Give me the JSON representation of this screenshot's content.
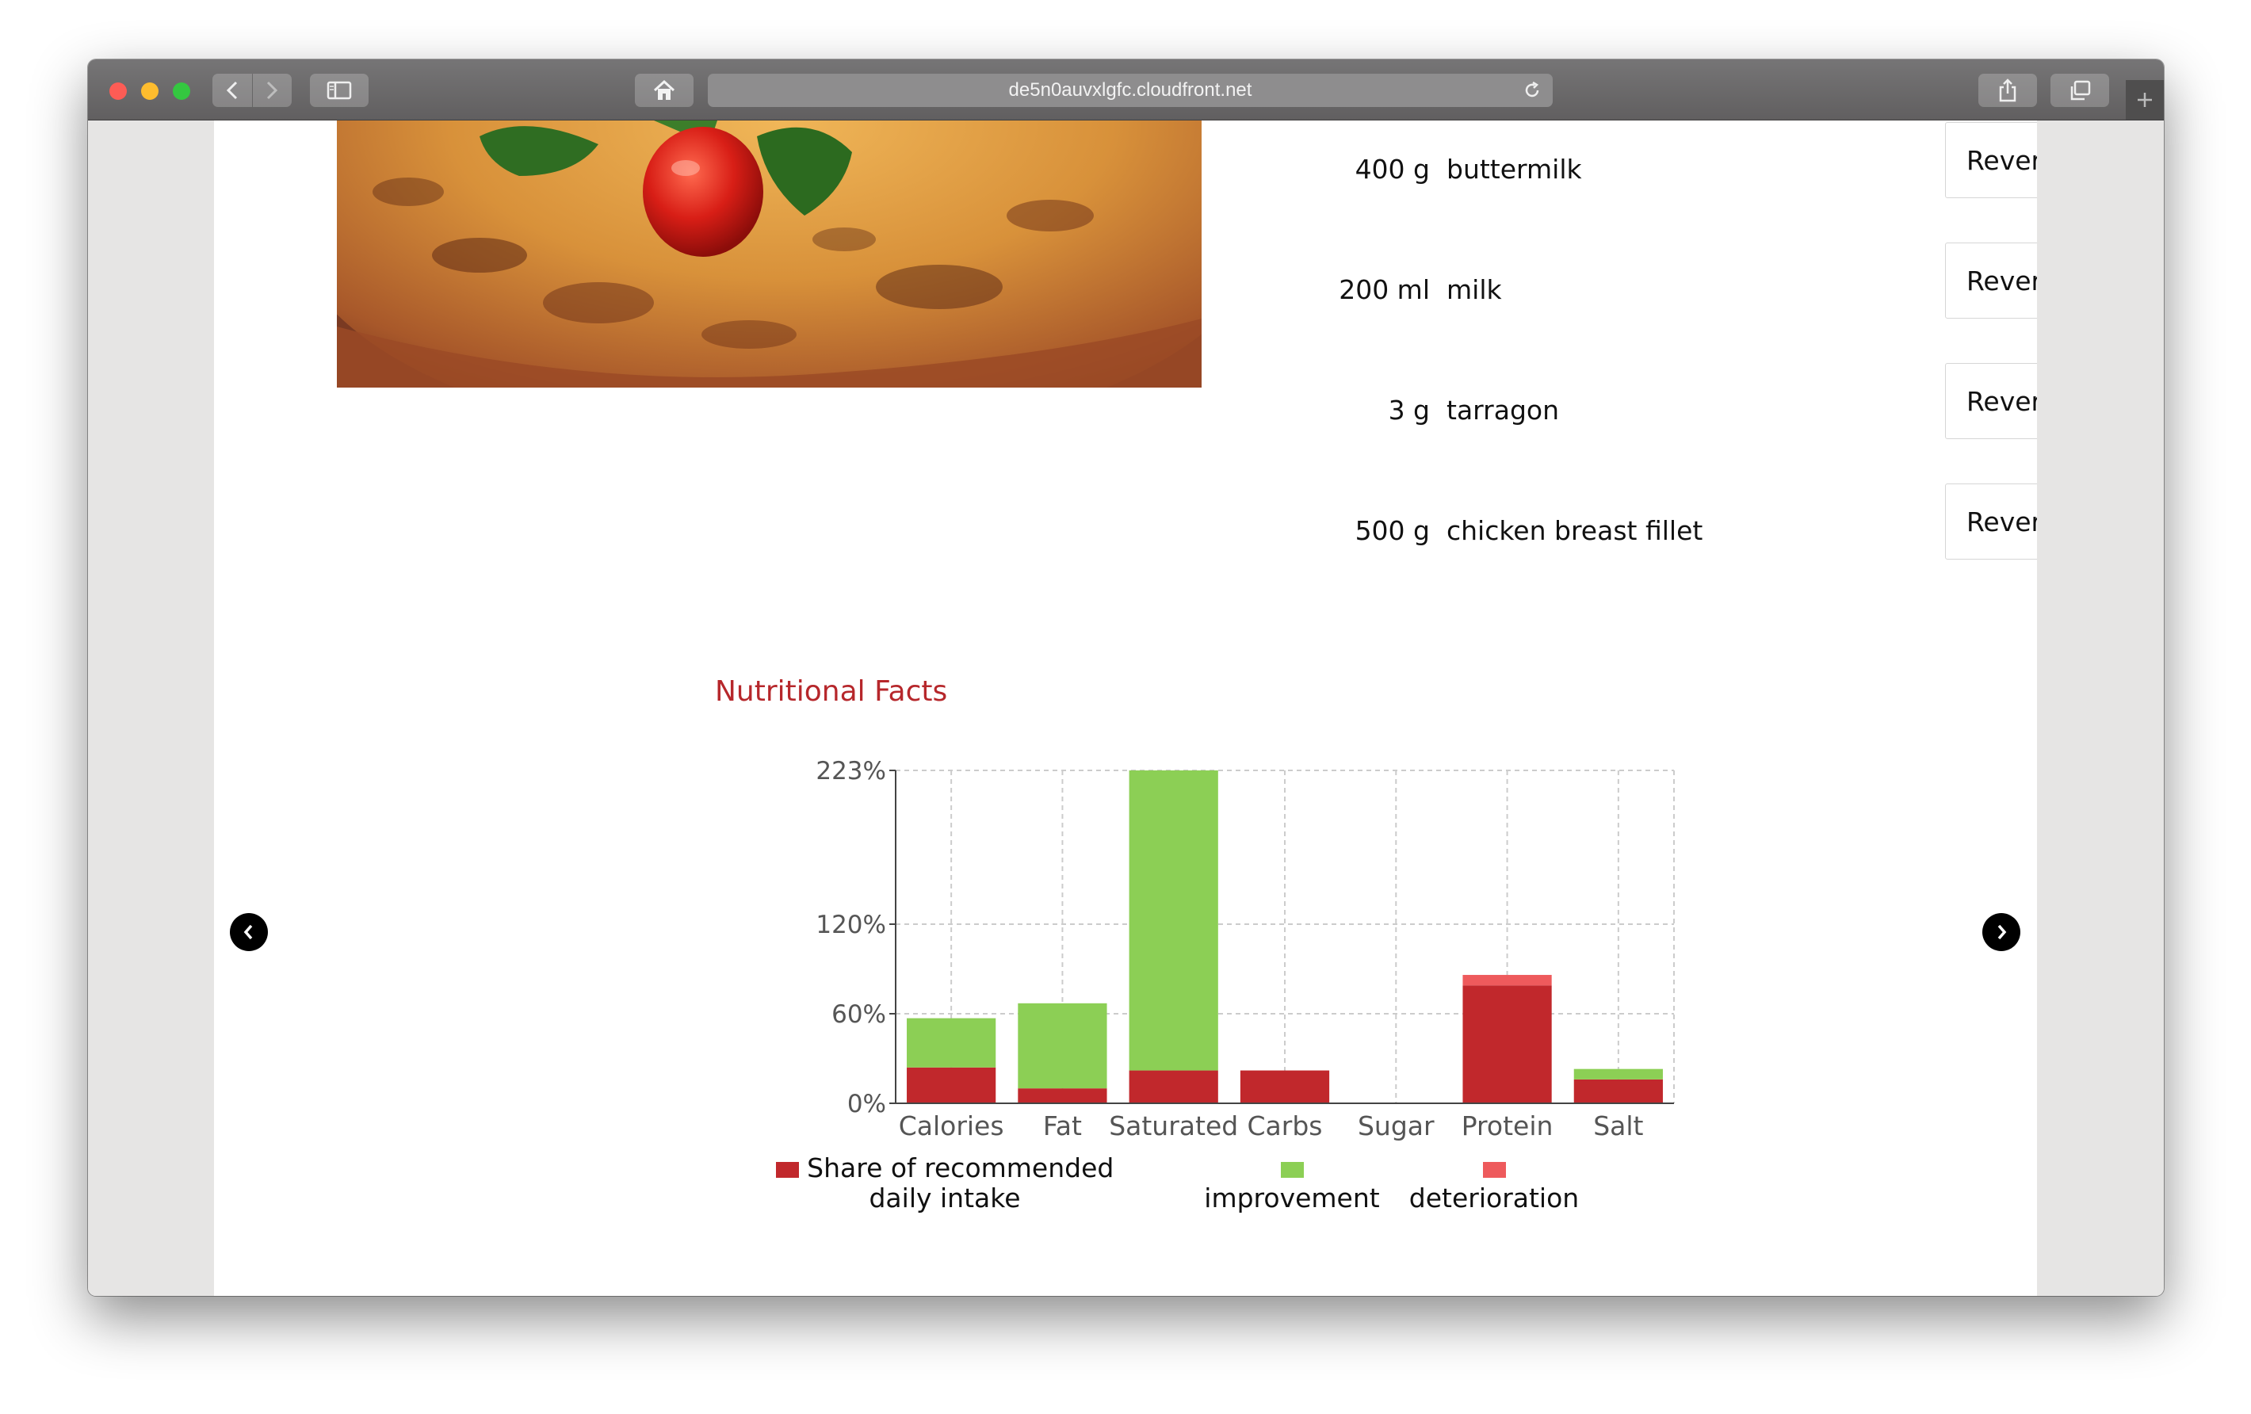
{
  "browser": {
    "url": "de5n0auvxlgfc.cloudfront.net"
  },
  "ingredients": [
    {
      "qty": "400 g",
      "name": "buttermilk",
      "action": "Revert"
    },
    {
      "qty": "200 ml",
      "name": "milk",
      "action": "Revert"
    },
    {
      "qty": "3 g",
      "name": "tarragon",
      "action": "Revert"
    },
    {
      "qty": "500 g",
      "name": "chicken breast fillet",
      "action": "Revert"
    }
  ],
  "nutrition": {
    "title": "Nutritional Facts"
  },
  "colors": {
    "share": "#c1282c",
    "improvement": "#8ccf55",
    "deterioration": "#ee5a5c",
    "title": "#b6272b"
  },
  "chart_data": {
    "type": "bar",
    "stacked": true,
    "categories": [
      "Calories",
      "Fat",
      "Saturated",
      "Carbs",
      "Sugar",
      "Protein",
      "Salt"
    ],
    "y_ticks": [
      "223%",
      "120%",
      "60%",
      "0%"
    ],
    "y_tick_values": [
      223,
      120,
      60,
      0
    ],
    "ylim": [
      0,
      223
    ],
    "grid": true,
    "legend_position": "bottom",
    "series": [
      {
        "name": "Share of recommended daily intake",
        "values": [
          24,
          10,
          22,
          22,
          0,
          79,
          16
        ]
      },
      {
        "name": "improvement",
        "values": [
          33,
          57,
          201,
          0,
          0,
          0,
          7
        ]
      },
      {
        "name": "deterioration",
        "values": [
          0,
          0,
          0,
          0,
          0,
          7,
          0
        ]
      }
    ]
  }
}
